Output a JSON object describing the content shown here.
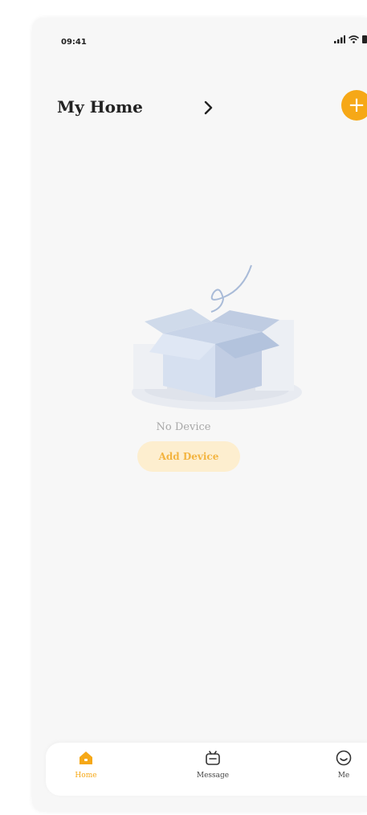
{
  "status_bar": {
    "time": "09:41"
  },
  "header": {
    "title": "My Home"
  },
  "empty_state": {
    "message": "No Device",
    "button_label": "Add Device"
  },
  "tabs": [
    {
      "label": "Home",
      "icon": "home-icon",
      "active": true
    },
    {
      "label": "Message",
      "icon": "message-icon",
      "active": false
    },
    {
      "label": "Me",
      "icon": "smile-icon",
      "active": false
    }
  ],
  "colors": {
    "accent": "#f6a817",
    "accent_soft": "#fdeecf",
    "background": "#f7f7f7"
  }
}
